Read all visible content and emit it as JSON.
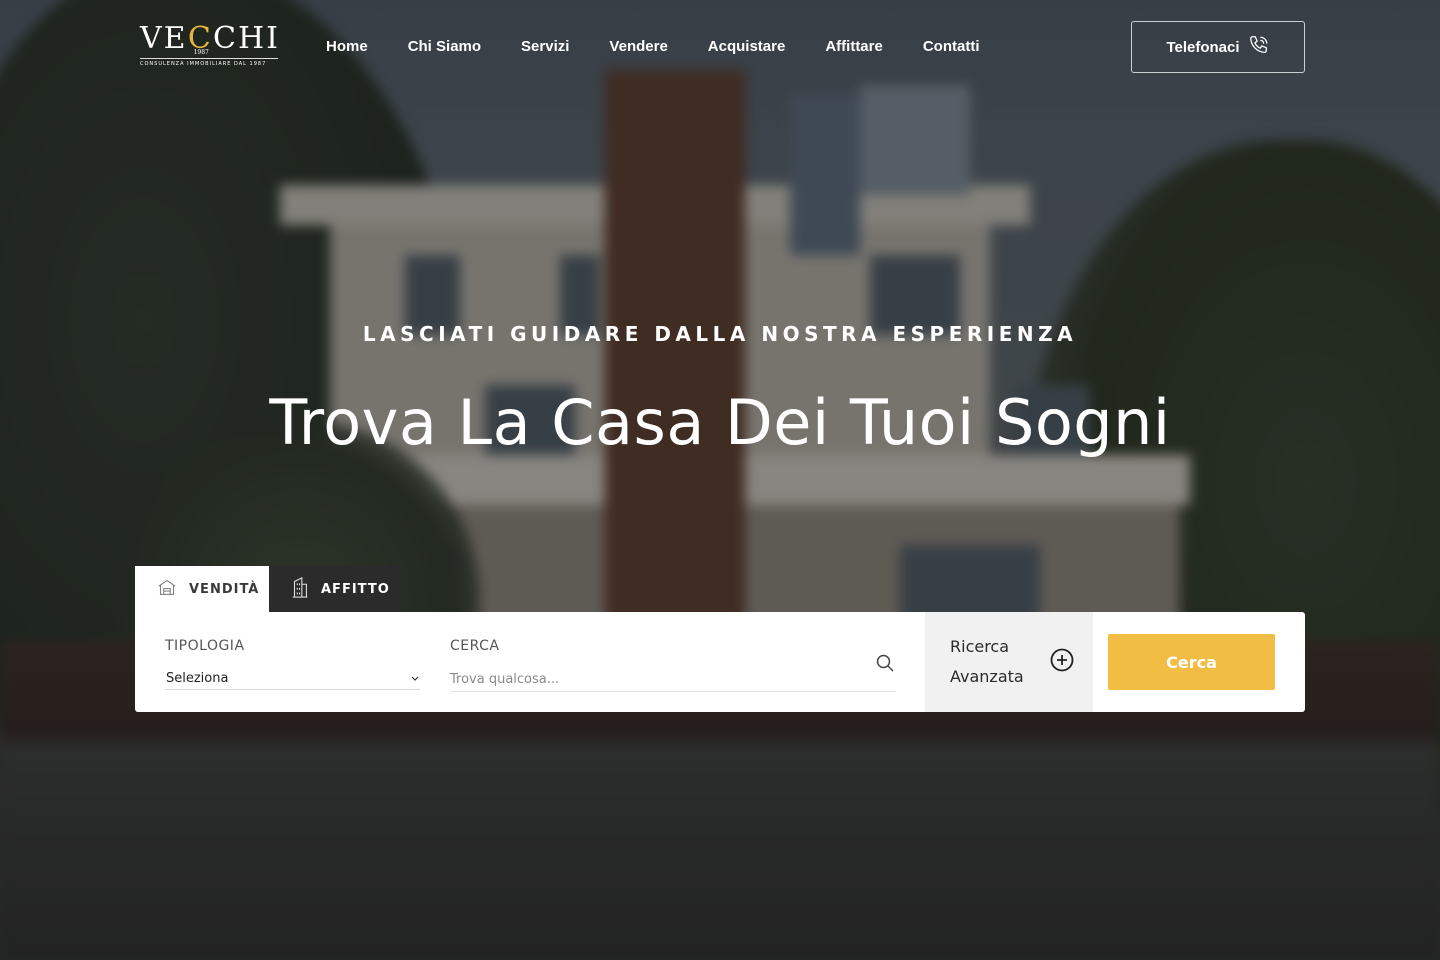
{
  "brand": {
    "logo_text_left": "VE",
    "logo_text_right": "CHI",
    "logo_mark": "C",
    "logo_sub": "1987",
    "tagline": "CONSULENZA IMMOBILIARE DAL 1987",
    "accent_color": "#f2bd45"
  },
  "nav": {
    "items": [
      "Home",
      "Chi Siamo",
      "Servizi",
      "Vendere",
      "Acquistare",
      "Affittare",
      "Contatti"
    ]
  },
  "header": {
    "call_label": "Telefonaci",
    "call_icon": "phone-icon"
  },
  "hero": {
    "kicker": "LASCIATI GUIDARE DALLA NOSTRA ESPERIENZA",
    "title": "Trova La Casa Dei Tuoi Sogni"
  },
  "search": {
    "tabs": [
      {
        "label": "VENDITÀ",
        "icon": "house-icon",
        "active": true
      },
      {
        "label": "AFFITTO",
        "icon": "building-icon",
        "active": false
      }
    ],
    "type_label": "TIPOLOGIA",
    "type_value": "Seleziona",
    "query_label": "CERCA",
    "query_placeholder": "Trova qualcosa...",
    "advanced_line1": "Ricerca",
    "advanced_line2": "Avanzata",
    "submit_label": "Cerca"
  }
}
